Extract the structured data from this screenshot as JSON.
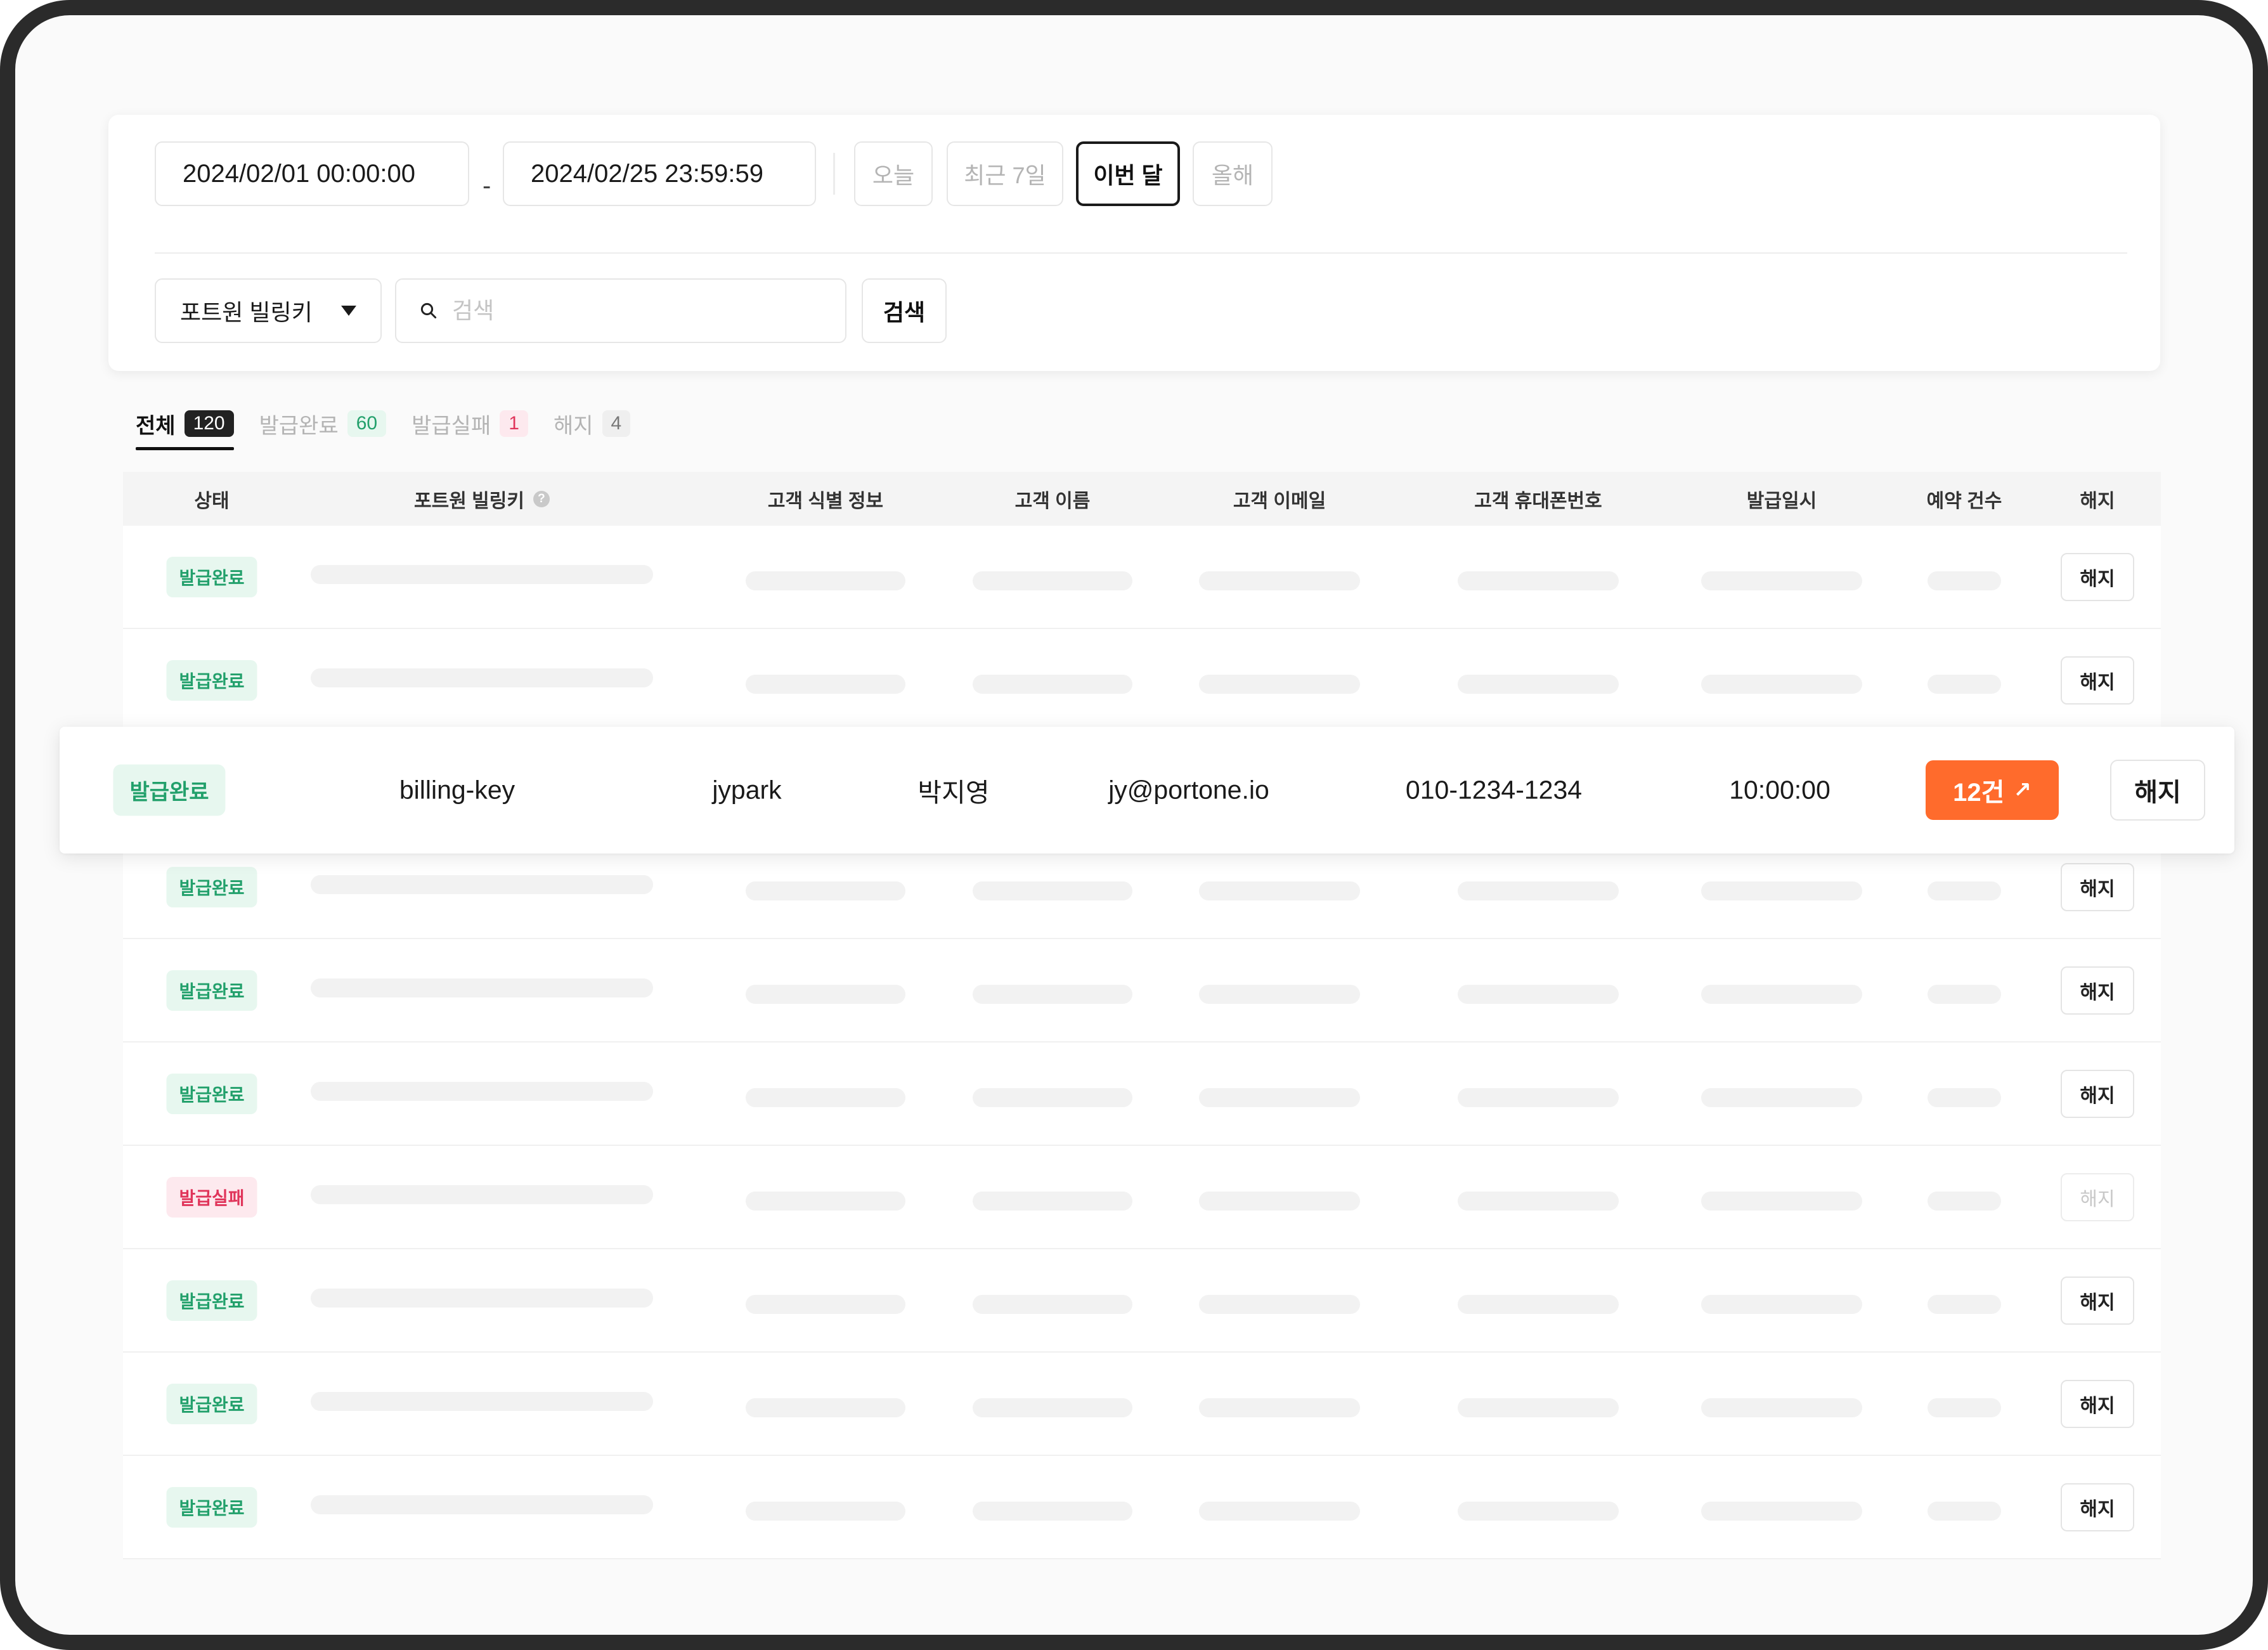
{
  "filters": {
    "start_date": "2024/02/01 00:00:00",
    "range_separator": "-",
    "end_date": "2024/02/25 23:59:59",
    "quick_ranges": [
      "오늘",
      "최근 7일",
      "이번 달",
      "올해"
    ],
    "active_range": "이번 달",
    "key_select": "포트원 빌링키",
    "search_placeholder": "검색",
    "search_button": "검색"
  },
  "tabs": [
    {
      "label": "전체",
      "count": "120",
      "active": true
    },
    {
      "label": "발급완료",
      "count": "60",
      "active": false
    },
    {
      "label": "발급실패",
      "count": "1",
      "active": false
    },
    {
      "label": "해지",
      "count": "4",
      "active": false
    }
  ],
  "table": {
    "columns": [
      "상태",
      "포트원 빌링키",
      "고객 식별 정보",
      "고객 이름",
      "고객 이메일",
      "고객 휴대폰번호",
      "발급일시",
      "예약 건수",
      "해지"
    ],
    "cancel_label": "해지",
    "rows": [
      {
        "status": "발급완료",
        "status_type": "success"
      },
      {
        "status": "발급완료",
        "status_type": "success"
      },
      {
        "status": "발급완료",
        "status_type": "success"
      },
      {
        "status": "발급완료",
        "status_type": "success"
      },
      {
        "status": "발급완료",
        "status_type": "success"
      },
      {
        "status": "발급실패",
        "status_type": "failed"
      },
      {
        "status": "발급완료",
        "status_type": "success"
      },
      {
        "status": "발급완료",
        "status_type": "success"
      },
      {
        "status": "발급완료",
        "status_type": "success"
      }
    ]
  },
  "highlighted_row": {
    "status": "발급완료",
    "billing_key": "billing-key",
    "customer_id": "jypark",
    "customer_name": "박지영",
    "customer_email": "jy@portone.io",
    "customer_phone": "010-1234-1234",
    "issued_at": "10:00:00",
    "reservation_count": "12건",
    "cancel_label": "해지"
  },
  "colors": {
    "accent_orange": "#ff6b2c",
    "success_green": "#22a06b",
    "failed_red": "#e0345a"
  }
}
